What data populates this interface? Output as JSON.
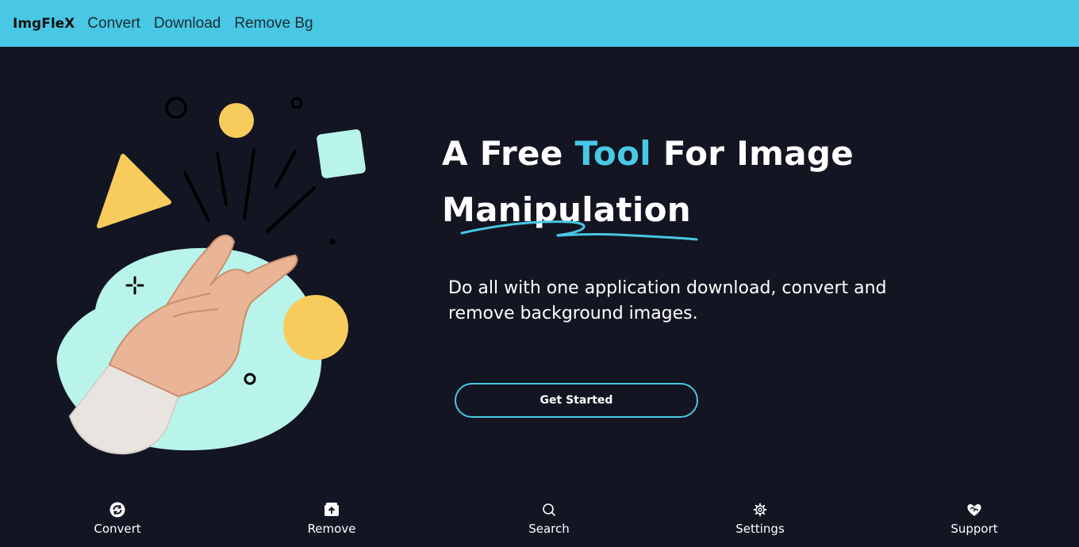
{
  "navbar": {
    "brand": "ImgFleX",
    "links": [
      "Convert",
      "Download",
      "Remove Bg"
    ],
    "background": "#48c8e4"
  },
  "hero": {
    "title_part1": "A Free ",
    "title_accent": "Tool",
    "title_part2": " For Image",
    "title_line2": "Manipulation",
    "subtitle": "Do all with one application download, convert and remove background images.",
    "cta_label": "Get Started",
    "accent_color": "#48c8e4"
  },
  "bottom_nav": {
    "items": [
      {
        "label": "Convert",
        "icon": "convert-icon"
      },
      {
        "label": "Remove",
        "icon": "remove-icon"
      },
      {
        "label": "Search",
        "icon": "search-icon"
      },
      {
        "label": "Settings",
        "icon": "gear-icon"
      },
      {
        "label": "Support",
        "icon": "heart-handshake-icon"
      }
    ]
  },
  "colors": {
    "background": "#131522",
    "mint": "#b8f4ea",
    "yellow": "#f8cc5c"
  }
}
